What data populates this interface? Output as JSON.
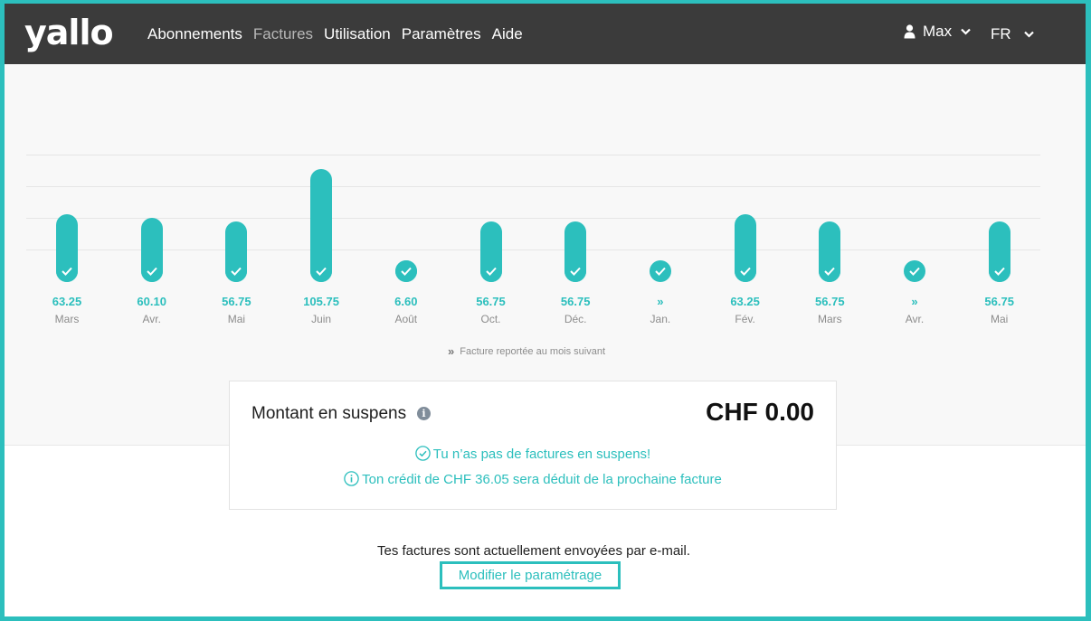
{
  "brand": {
    "logo_text": "yallo",
    "accent_color": "#2cbfbd",
    "topbar_color": "#3b3b3b"
  },
  "nav": {
    "items": [
      {
        "label": "Abonnements",
        "active": false
      },
      {
        "label": "Factures",
        "active": true
      },
      {
        "label": "Utilisation",
        "active": false
      },
      {
        "label": "Paramètres",
        "active": false
      },
      {
        "label": "Aide",
        "active": false
      }
    ]
  },
  "user": {
    "name": "Max",
    "icon": "user-icon"
  },
  "language": {
    "current": "FR"
  },
  "chart_data": {
    "type": "bar",
    "categories": [
      "Mars",
      "Avr.",
      "Mai",
      "Juin",
      "Août",
      "Oct.",
      "Déc.",
      "Jan.",
      "Fév.",
      "Mars",
      "Avr.",
      "Mai"
    ],
    "value_labels": [
      "63.25",
      "60.10",
      "56.75",
      "105.75",
      "6.60",
      "56.75",
      "56.75",
      "»",
      "63.25",
      "56.75",
      "»",
      "56.75"
    ],
    "values": [
      63.25,
      60.1,
      56.75,
      105.75,
      6.6,
      56.75,
      56.75,
      0,
      63.25,
      56.75,
      0,
      56.75
    ],
    "paid": [
      true,
      true,
      true,
      true,
      true,
      true,
      true,
      true,
      true,
      true,
      true,
      true
    ],
    "deferred": [
      false,
      false,
      false,
      false,
      false,
      false,
      false,
      true,
      false,
      false,
      true,
      false
    ],
    "grid": true,
    "legend_note": "Facture reportée au mois suivant"
  },
  "outstanding": {
    "title": "Montant en suspens",
    "amount": "CHF 0.00",
    "status_message": "Tu n’as pas de factures en suspens!",
    "credit_message": "Ton crédit de CHF 36.05 sera déduit de la prochaine facture"
  },
  "delivery": {
    "text": "Tes factures sont actuellement envoyées par e-mail.",
    "modify_label": "Modifier le paramétrage"
  }
}
